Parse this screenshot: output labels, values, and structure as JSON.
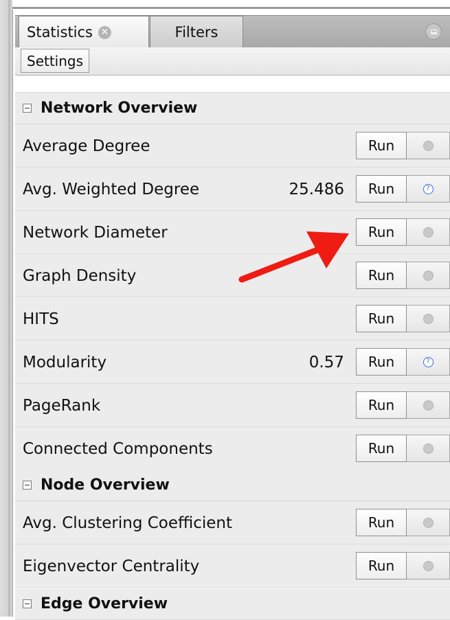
{
  "tabs": {
    "statistics": "Statistics",
    "filters": "Filters",
    "close_glyph": "✕"
  },
  "settings_label": "Settings",
  "sections": {
    "network": {
      "title": "Network Overview",
      "rows": [
        {
          "name": "Average Degree",
          "value": "",
          "run": "Run",
          "help_active": false
        },
        {
          "name": "Avg. Weighted Degree",
          "value": "25.486",
          "run": "Run",
          "help_active": true
        },
        {
          "name": "Network Diameter",
          "value": "",
          "run": "Run",
          "help_active": false
        },
        {
          "name": "Graph Density",
          "value": "",
          "run": "Run",
          "help_active": false
        },
        {
          "name": "HITS",
          "value": "",
          "run": "Run",
          "help_active": false
        },
        {
          "name": "Modularity",
          "value": "0.57",
          "run": "Run",
          "help_active": true
        },
        {
          "name": "PageRank",
          "value": "",
          "run": "Run",
          "help_active": false
        },
        {
          "name": "Connected Components",
          "value": "",
          "run": "Run",
          "help_active": false
        }
      ]
    },
    "node": {
      "title": "Node Overview",
      "rows": [
        {
          "name": "Avg. Clustering Coefficient",
          "value": "",
          "run": "Run",
          "help_active": false
        },
        {
          "name": "Eigenvector Centrality",
          "value": "",
          "run": "Run",
          "help_active": false
        }
      ]
    },
    "edge": {
      "title": "Edge Overview"
    }
  },
  "icons": {
    "help": "help-icon",
    "collapse": "collapse-icon",
    "close": "close-icon",
    "minimize": "minimize-icon"
  },
  "colors": {
    "annotation_arrow": "#ee1c13",
    "help_active": "#3f64d8"
  }
}
